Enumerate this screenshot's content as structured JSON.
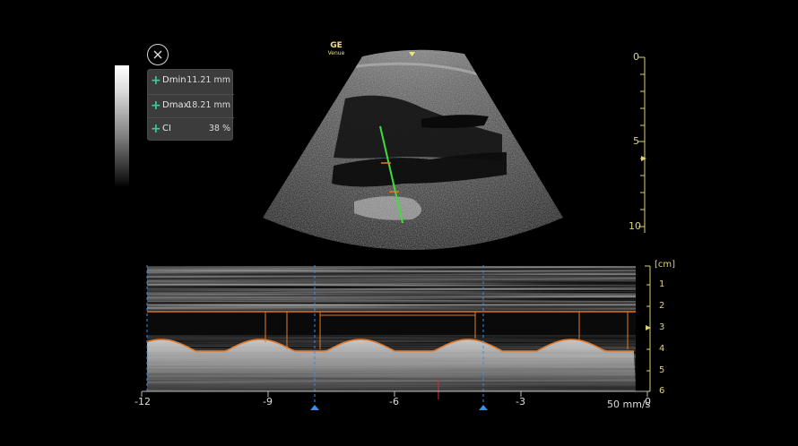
{
  "vendor": {
    "brand": "GE",
    "model": "Venue"
  },
  "measurements": [
    {
      "label": "Dmin",
      "value": "11.21 mm"
    },
    {
      "label": "Dmax",
      "value": "18.21 mm"
    },
    {
      "label": "CI",
      "value": "38 %"
    }
  ],
  "depth_scale": {
    "labels": [
      "0",
      "5",
      "10"
    ],
    "unit": "cm"
  },
  "mmode_depth_scale": {
    "unit_label": "[cm]",
    "labels": [
      "1",
      "2",
      "3",
      "4",
      "5",
      "6"
    ]
  },
  "time_axis": {
    "labels": [
      "-12",
      "-9",
      "-6",
      "-3",
      "0"
    ]
  },
  "sweep_speed": "50 mm/s",
  "colors": {
    "caliper": "#3fdc3f",
    "trace": "#e07a2a",
    "scale": "#dcd27a",
    "cursor": "#3a8ee6",
    "accent": "#2fd39a"
  }
}
